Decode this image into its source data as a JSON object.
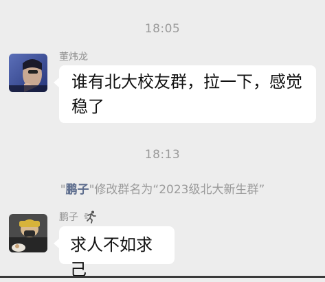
{
  "timestamps": [
    "18:05",
    "18:13"
  ],
  "messages": [
    {
      "sender": "董炜龙",
      "text": "谁有北大校友群，拉一下，感觉稳了"
    },
    {
      "sender": "鹏子",
      "text": "求人不如求己"
    }
  ],
  "system_notice": {
    "open_quote": "\"",
    "nickname": "鹏子",
    "middle": "\"修改群名为“2023级北大新生群”"
  },
  "colors": {
    "background": "#ededed",
    "bubble": "#ffffff",
    "nickname_link": "#5b6b8c"
  }
}
